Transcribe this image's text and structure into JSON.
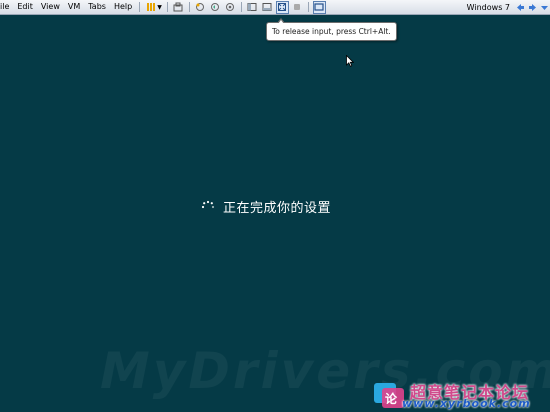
{
  "menu": {
    "items": [
      "ile",
      "Edit",
      "View",
      "VM",
      "Tabs",
      "Help"
    ]
  },
  "toolbar": {
    "vm_name": "Windows 7",
    "icons": [
      "library-icon",
      "snapshot-icon",
      "revert-snapshot-icon",
      "manage-snapshots-icon",
      "normal-view-icon",
      "quick-switch-icon",
      "full-screen-icon",
      "unity-icon",
      "console-view-icon",
      "back-arrow-icon",
      "forward-arrow-icon"
    ]
  },
  "tooltip": {
    "text": "To release input, press Ctrl+Alt."
  },
  "guest": {
    "status_text": "正在完成你的设置",
    "background_color": "#053a46"
  },
  "watermark": {
    "main": "MyDrivers.com",
    "logo_title": "超意笔记本论坛",
    "logo_url": "www.xyrbook.com"
  }
}
